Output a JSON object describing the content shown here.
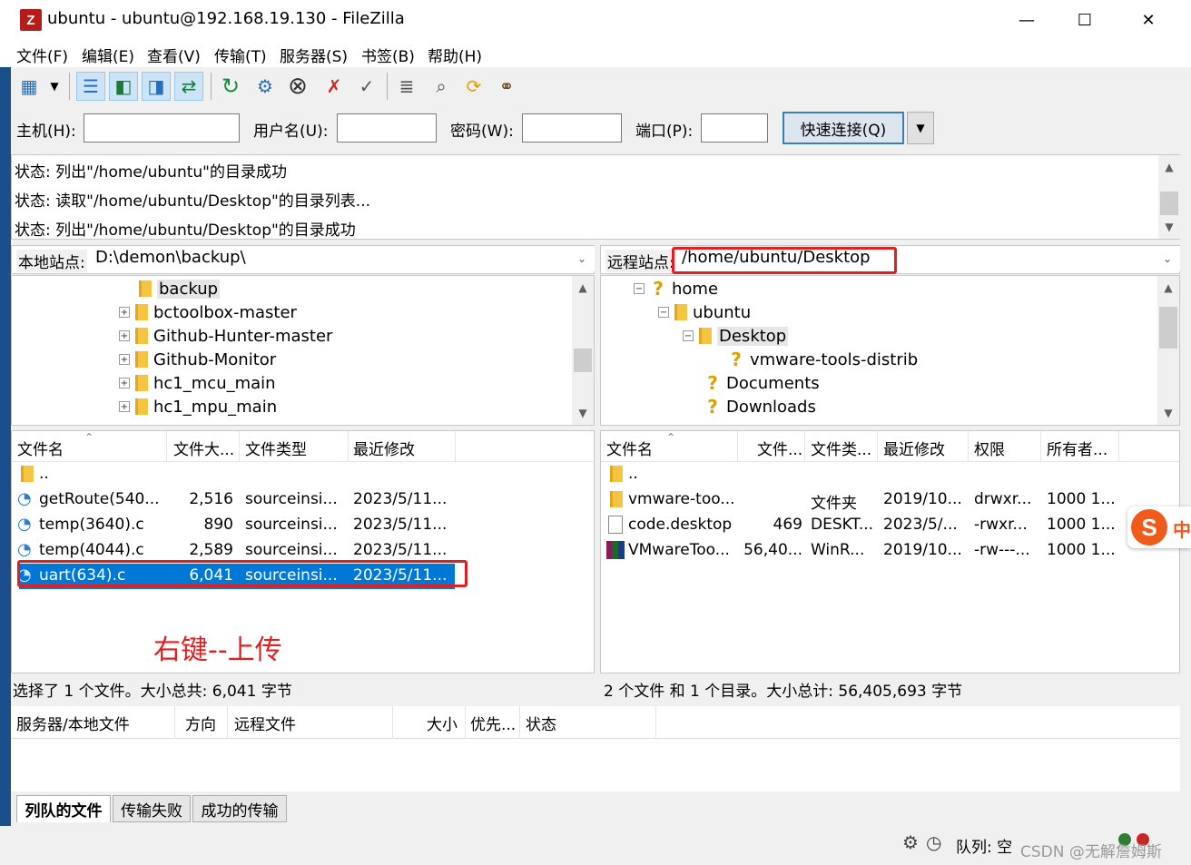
{
  "title": {
    "app_initial": "Z",
    "text": "ubuntu - ubuntu@192.168.19.130 - FileZilla"
  },
  "window_controls": {
    "minimize": "—",
    "maximize": "☐",
    "close": "✕"
  },
  "menu": [
    "文件(F)",
    "编辑(E)",
    "查看(V)",
    "传输(T)",
    "服务器(S)",
    "书签(B)",
    "帮助(H)"
  ],
  "quickconnect": {
    "host_label": "主机(H):",
    "user_label": "用户名(U):",
    "pass_label": "密码(W):",
    "port_label": "端口(P):",
    "connect_button": "快速连接(Q)",
    "host_value": "",
    "user_value": "",
    "pass_value": "",
    "port_value": ""
  },
  "log": [
    "状态:  列出\"/home/ubuntu\"的目录成功",
    "状态:  读取\"/home/ubuntu/Desktop\"的目录列表...",
    "状态:  列出\"/home/ubuntu/Desktop\"的目录成功"
  ],
  "local": {
    "site_label": "本地站点:",
    "path": "D:\\demon\\backup\\",
    "tree": [
      "backup",
      "bctoolbox-master",
      "Github-Hunter-master",
      "Github-Monitor",
      "hc1_mcu_main",
      "hc1_mpu_main"
    ],
    "columns": [
      "文件名",
      "文件大...",
      "文件类型",
      "最近修改"
    ],
    "files": [
      {
        "name": "..",
        "size": "",
        "type": "",
        "modified": ""
      },
      {
        "name": "getRoute(540...",
        "size": "2,516",
        "type": "sourceinsi...",
        "modified": "2023/5/11..."
      },
      {
        "name": "temp(3640).c",
        "size": "890",
        "type": "sourceinsi...",
        "modified": "2023/5/11..."
      },
      {
        "name": "temp(4044).c",
        "size": "2,589",
        "type": "sourceinsi...",
        "modified": "2023/5/11..."
      },
      {
        "name": "uart(634).c",
        "size": "6,041",
        "type": "sourceinsi...",
        "modified": "2023/5/11..."
      }
    ],
    "status": "选择了 1 个文件。大小总共: 6,041 字节"
  },
  "remote": {
    "site_label": "远程站点:",
    "path": "/home/ubuntu/Desktop",
    "tree": [
      "home",
      "ubuntu",
      "Desktop",
      "vmware-tools-distrib",
      "Documents",
      "Downloads"
    ],
    "columns": [
      "文件名",
      "文件...",
      "文件类...",
      "最近修改",
      "权限",
      "所有者..."
    ],
    "files": [
      {
        "name": "..",
        "size": "",
        "type": "",
        "modified": "",
        "perm": "",
        "owner": ""
      },
      {
        "name": "vmware-too...",
        "size": "",
        "type": "文件夹",
        "modified": "2019/10...",
        "perm": "drwxr...",
        "owner": "1000 1..."
      },
      {
        "name": "code.desktop",
        "size": "469",
        "type": "DESKT...",
        "modified": "2023/5/...",
        "perm": "-rwxr...",
        "owner": "1000 1..."
      },
      {
        "name": "VMwareToo...",
        "size": "56,40...",
        "type": "WinR...",
        "modified": "2019/10...",
        "perm": "-rw---...",
        "owner": "1000 1..."
      }
    ],
    "status": "2 个文件 和 1 个目录。大小总计: 56,405,693 字节"
  },
  "annotation": "右键--上传",
  "queue": {
    "columns": [
      "服务器/本地文件",
      "方向",
      "远程文件",
      "大小",
      "优先...",
      "状态"
    ],
    "tabs": [
      "列队的文件",
      "传输失败",
      "成功的传输"
    ],
    "queue_status": "队列: 空"
  },
  "ime_badge": "中",
  "watermark": "CSDN @无解詹姆斯"
}
